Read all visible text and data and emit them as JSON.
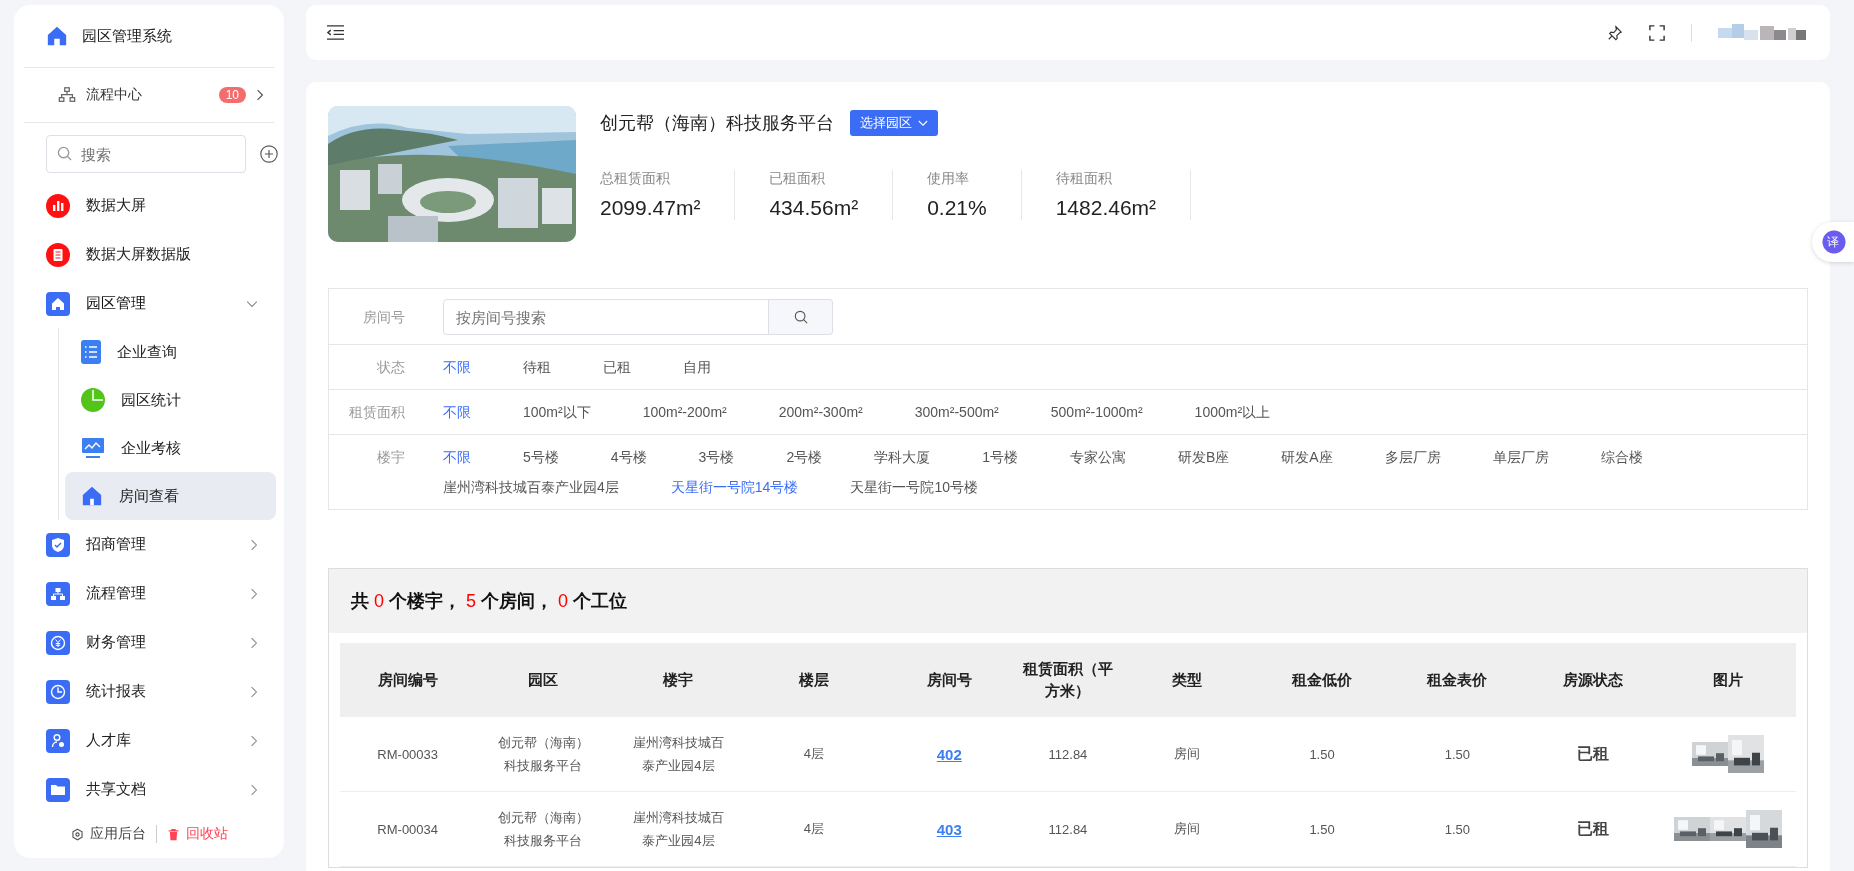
{
  "sidebar": {
    "app_title": "园区管理系统",
    "process_center": {
      "label": "流程中心",
      "badge": "10"
    },
    "search": {
      "placeholder": "搜索"
    },
    "items": [
      {
        "label": "数据大屏",
        "kind": "link"
      },
      {
        "label": "数据大屏数据版",
        "kind": "link"
      },
      {
        "label": "园区管理",
        "kind": "group",
        "expanded": true,
        "children": [
          {
            "label": "企业查询",
            "selected": false
          },
          {
            "label": "园区统计",
            "selected": false
          },
          {
            "label": "企业考核",
            "selected": false
          },
          {
            "label": "房间查看",
            "selected": true
          }
        ]
      },
      {
        "label": "招商管理",
        "kind": "group",
        "expanded": false
      },
      {
        "label": "流程管理",
        "kind": "group",
        "expanded": false
      },
      {
        "label": "财务管理",
        "kind": "group",
        "expanded": false
      },
      {
        "label": "统计报表",
        "kind": "group",
        "expanded": false
      },
      {
        "label": "人才库",
        "kind": "group",
        "expanded": false
      },
      {
        "label": "共享文档",
        "kind": "group",
        "expanded": false
      }
    ],
    "footer": {
      "admin": "应用后台",
      "recycle": "回收站"
    }
  },
  "translate_button": "译",
  "park": {
    "name": "创元帮（海南）科技服务平台",
    "select_button": "选择园区",
    "stats": [
      {
        "label": "总租赁面积",
        "value": "2099.47m²"
      },
      {
        "label": "已租面积",
        "value": "434.56m²"
      },
      {
        "label": "使用率",
        "value": "0.21%"
      },
      {
        "label": "待租面积",
        "value": "1482.46m²"
      }
    ]
  },
  "filters": {
    "room_search": {
      "label": "房间号",
      "placeholder": "按房间号搜索"
    },
    "groups": [
      {
        "label": "状态",
        "options": [
          {
            "label": "不限",
            "selected": true
          },
          {
            "label": "待租",
            "selected": false
          },
          {
            "label": "已租",
            "selected": false
          },
          {
            "label": "自用",
            "selected": false
          }
        ]
      },
      {
        "label": "租赁面积",
        "options": [
          {
            "label": "不限",
            "selected": true
          },
          {
            "label": "100m²以下",
            "selected": false
          },
          {
            "label": "100m²-200m²",
            "selected": false
          },
          {
            "label": "200m²-300m²",
            "selected": false
          },
          {
            "label": "300m²-500m²",
            "selected": false
          },
          {
            "label": "500m²-1000m²",
            "selected": false
          },
          {
            "label": "1000m²以上",
            "selected": false
          }
        ]
      },
      {
        "label": "楼宇",
        "options": [
          {
            "label": "不限",
            "selected": true
          },
          {
            "label": "5号楼",
            "selected": false
          },
          {
            "label": "4号楼",
            "selected": false
          },
          {
            "label": "3号楼",
            "selected": false
          },
          {
            "label": "2号楼",
            "selected": false
          },
          {
            "label": "学科大厦",
            "selected": false
          },
          {
            "label": "1号楼",
            "selected": false
          },
          {
            "label": "专家公寓",
            "selected": false
          },
          {
            "label": "研发B座",
            "selected": false
          },
          {
            "label": "研发A座",
            "selected": false
          },
          {
            "label": "多层厂房",
            "selected": false
          },
          {
            "label": "单层厂房",
            "selected": false
          },
          {
            "label": "综合楼",
            "selected": false
          },
          {
            "label": "崖州湾科技城百泰产业园4层",
            "selected": false
          },
          {
            "label": "天星街一号院14号楼",
            "selected": true
          },
          {
            "label": "天星街一号院10号楼",
            "selected": false
          }
        ]
      }
    ]
  },
  "summary": [
    {
      "text": "共 ",
      "emphasis": false
    },
    {
      "text": "0",
      "emphasis": true
    },
    {
      "text": " 个楼宇， ",
      "emphasis": false
    },
    {
      "text": "5",
      "emphasis": true
    },
    {
      "text": " 个房间， ",
      "emphasis": false
    },
    {
      "text": "0",
      "emphasis": true
    },
    {
      "text": " 个工位",
      "emphasis": false
    }
  ],
  "table": {
    "columns": [
      "房间编号",
      "园区",
      "楼宇",
      "楼层",
      "房间号",
      "租赁面积（平方米）",
      "类型",
      "租金低价",
      "租金表价",
      "房源状态",
      "图片"
    ],
    "rows": [
      {
        "code": "RM-00033",
        "park": "创元帮（海南）科技服务平台",
        "building": "崖州湾科技城百泰产业园4层",
        "floor": "4层",
        "room": "402",
        "area": "112.84",
        "type": "房间",
        "low_price": "1.50",
        "list_price": "1.50",
        "status": "已租"
      },
      {
        "code": "RM-00034",
        "park": "创元帮（海南）科技服务平台",
        "building": "崖州湾科技城百泰产业园4层",
        "floor": "4层",
        "room": "403",
        "area": "112.84",
        "type": "房间",
        "low_price": "1.50",
        "list_price": "1.50",
        "status": "已租"
      }
    ]
  }
}
